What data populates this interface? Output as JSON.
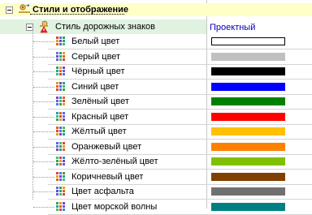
{
  "tree": {
    "section": {
      "label": "Стили и отображение"
    },
    "style_group": {
      "label": "Стиль дорожных знаков",
      "value": "Проектный"
    },
    "colors": [
      {
        "label": "Белый цвет",
        "color": "#ffffff"
      },
      {
        "label": "Серый цвет",
        "color": "#c0c0c0"
      },
      {
        "label": "Чёрный цвет",
        "color": "#000000"
      },
      {
        "label": "Синий цвет",
        "color": "#0000ff"
      },
      {
        "label": "Зелёный цвет",
        "color": "#008000"
      },
      {
        "label": "Красный цвет",
        "color": "#ff0000"
      },
      {
        "label": "Жёлтый цвет",
        "color": "#ffc000"
      },
      {
        "label": "Оранжевый цвет",
        "color": "#ff8000"
      },
      {
        "label": "Жёлто-зелёный цвет",
        "color": "#80c000"
      },
      {
        "label": "Коричневый цвет",
        "color": "#804000"
      },
      {
        "label": "Цвет асфальта",
        "color": "#707070"
      },
      {
        "label": "Цвет морской волны",
        "color": "#008080"
      }
    ]
  },
  "colors": {
    "section_bg": "#ffffc8",
    "group_bg": "#e0f2e0",
    "value_text": "#0000c0"
  },
  "icons": {
    "section": "properties-icon",
    "group": "style-warning-icon",
    "item": "color-grid-icon"
  }
}
